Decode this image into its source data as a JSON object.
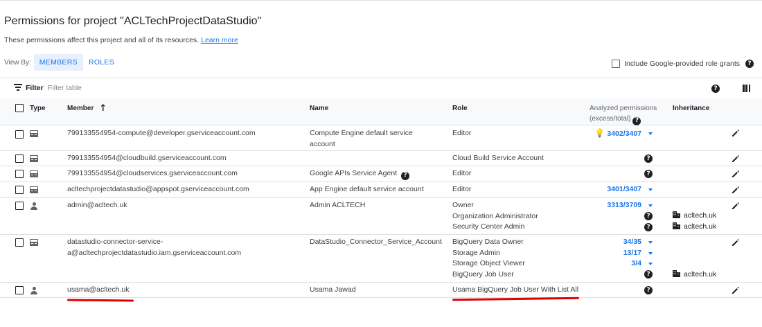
{
  "header": {
    "title": "Permissions for project \"ACLTechProjectDataStudio\"",
    "subtitle": "These permissions affect this project and all of its resources.",
    "learn_more": "Learn more"
  },
  "view_by": {
    "label": "View By:",
    "members": "MEMBERS",
    "roles": "ROLES"
  },
  "include_google_grants": "Include Google-provided role grants",
  "filter": {
    "label": "Filter",
    "placeholder": "Filter table"
  },
  "columns": {
    "type": "Type",
    "member": "Member",
    "name": "Name",
    "role": "Role",
    "analyzed_line1": "Analyzed permissions",
    "analyzed_line2": "(excess/total)",
    "inheritance": "Inheritance"
  },
  "rows": [
    {
      "member": "799133554954-compute@developer.gserviceaccount.com",
      "name_l1": "Compute Engine default service",
      "name_l2": "account",
      "role": "Editor",
      "perm": "3402/3407"
    },
    {
      "member": "799133554954@cloudbuild.gserviceaccount.com",
      "role": "Cloud Build Service Account"
    },
    {
      "member": "799133554954@cloudservices.gserviceaccount.com",
      "name": "Google APIs Service Agent",
      "role": "Editor"
    },
    {
      "member": "acltechprojectdatastudio@appspot.gserviceaccount.com",
      "name": "App Engine default service account",
      "role": "Editor",
      "perm": "3401/3407"
    },
    {
      "member": "admin@acltech.uk",
      "name": "Admin ACLTECH",
      "roles": [
        "Owner",
        "Organization Administrator",
        "Security Center Admin"
      ],
      "perm": "3313/3709",
      "inherit": "acltech.uk"
    },
    {
      "member_l1": "datastudio-connector-service-",
      "member_l2": "a@acltechprojectdatastudio.iam.gserviceaccount.com",
      "name": "DataStudio_Connector_Service_Account",
      "roles": [
        "BigQuery Data Owner",
        "Storage Admin",
        "Storage Object Viewer",
        "BigQuery Job User"
      ],
      "perms": [
        "34/35",
        "13/17",
        "3/4"
      ],
      "inherit": "acltech.uk"
    },
    {
      "member": "usama@acltech.uk",
      "name": "Usama Jawad",
      "role": "Usama BigQuery Job User With List All"
    }
  ]
}
